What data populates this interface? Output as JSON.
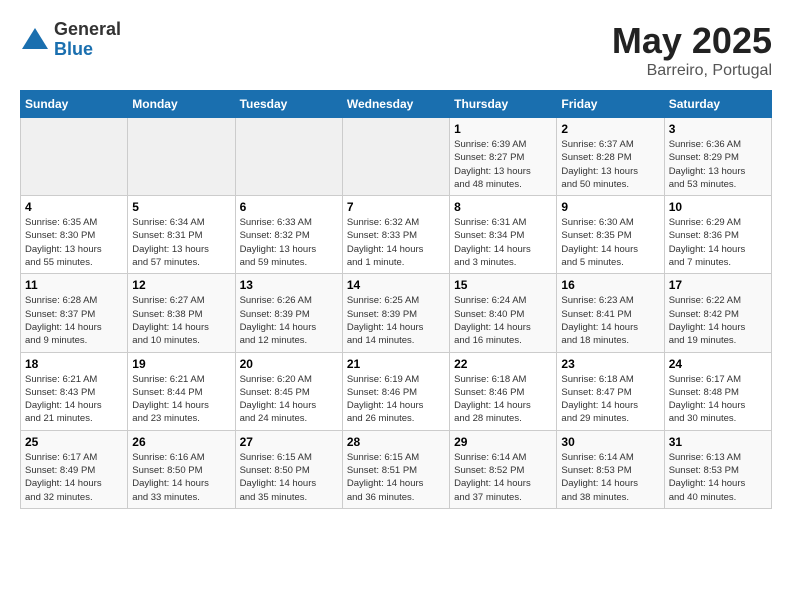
{
  "header": {
    "logo_general": "General",
    "logo_blue": "Blue",
    "title": "May 2025",
    "subtitle": "Barreiro, Portugal"
  },
  "weekdays": [
    "Sunday",
    "Monday",
    "Tuesday",
    "Wednesday",
    "Thursday",
    "Friday",
    "Saturday"
  ],
  "weeks": [
    [
      {
        "day": "",
        "info": ""
      },
      {
        "day": "",
        "info": ""
      },
      {
        "day": "",
        "info": ""
      },
      {
        "day": "",
        "info": ""
      },
      {
        "day": "1",
        "info": "Sunrise: 6:39 AM\nSunset: 8:27 PM\nDaylight: 13 hours\nand 48 minutes."
      },
      {
        "day": "2",
        "info": "Sunrise: 6:37 AM\nSunset: 8:28 PM\nDaylight: 13 hours\nand 50 minutes."
      },
      {
        "day": "3",
        "info": "Sunrise: 6:36 AM\nSunset: 8:29 PM\nDaylight: 13 hours\nand 53 minutes."
      }
    ],
    [
      {
        "day": "4",
        "info": "Sunrise: 6:35 AM\nSunset: 8:30 PM\nDaylight: 13 hours\nand 55 minutes."
      },
      {
        "day": "5",
        "info": "Sunrise: 6:34 AM\nSunset: 8:31 PM\nDaylight: 13 hours\nand 57 minutes."
      },
      {
        "day": "6",
        "info": "Sunrise: 6:33 AM\nSunset: 8:32 PM\nDaylight: 13 hours\nand 59 minutes."
      },
      {
        "day": "7",
        "info": "Sunrise: 6:32 AM\nSunset: 8:33 PM\nDaylight: 14 hours\nand 1 minute."
      },
      {
        "day": "8",
        "info": "Sunrise: 6:31 AM\nSunset: 8:34 PM\nDaylight: 14 hours\nand 3 minutes."
      },
      {
        "day": "9",
        "info": "Sunrise: 6:30 AM\nSunset: 8:35 PM\nDaylight: 14 hours\nand 5 minutes."
      },
      {
        "day": "10",
        "info": "Sunrise: 6:29 AM\nSunset: 8:36 PM\nDaylight: 14 hours\nand 7 minutes."
      }
    ],
    [
      {
        "day": "11",
        "info": "Sunrise: 6:28 AM\nSunset: 8:37 PM\nDaylight: 14 hours\nand 9 minutes."
      },
      {
        "day": "12",
        "info": "Sunrise: 6:27 AM\nSunset: 8:38 PM\nDaylight: 14 hours\nand 10 minutes."
      },
      {
        "day": "13",
        "info": "Sunrise: 6:26 AM\nSunset: 8:39 PM\nDaylight: 14 hours\nand 12 minutes."
      },
      {
        "day": "14",
        "info": "Sunrise: 6:25 AM\nSunset: 8:39 PM\nDaylight: 14 hours\nand 14 minutes."
      },
      {
        "day": "15",
        "info": "Sunrise: 6:24 AM\nSunset: 8:40 PM\nDaylight: 14 hours\nand 16 minutes."
      },
      {
        "day": "16",
        "info": "Sunrise: 6:23 AM\nSunset: 8:41 PM\nDaylight: 14 hours\nand 18 minutes."
      },
      {
        "day": "17",
        "info": "Sunrise: 6:22 AM\nSunset: 8:42 PM\nDaylight: 14 hours\nand 19 minutes."
      }
    ],
    [
      {
        "day": "18",
        "info": "Sunrise: 6:21 AM\nSunset: 8:43 PM\nDaylight: 14 hours\nand 21 minutes."
      },
      {
        "day": "19",
        "info": "Sunrise: 6:21 AM\nSunset: 8:44 PM\nDaylight: 14 hours\nand 23 minutes."
      },
      {
        "day": "20",
        "info": "Sunrise: 6:20 AM\nSunset: 8:45 PM\nDaylight: 14 hours\nand 24 minutes."
      },
      {
        "day": "21",
        "info": "Sunrise: 6:19 AM\nSunset: 8:46 PM\nDaylight: 14 hours\nand 26 minutes."
      },
      {
        "day": "22",
        "info": "Sunrise: 6:18 AM\nSunset: 8:46 PM\nDaylight: 14 hours\nand 28 minutes."
      },
      {
        "day": "23",
        "info": "Sunrise: 6:18 AM\nSunset: 8:47 PM\nDaylight: 14 hours\nand 29 minutes."
      },
      {
        "day": "24",
        "info": "Sunrise: 6:17 AM\nSunset: 8:48 PM\nDaylight: 14 hours\nand 30 minutes."
      }
    ],
    [
      {
        "day": "25",
        "info": "Sunrise: 6:17 AM\nSunset: 8:49 PM\nDaylight: 14 hours\nand 32 minutes."
      },
      {
        "day": "26",
        "info": "Sunrise: 6:16 AM\nSunset: 8:50 PM\nDaylight: 14 hours\nand 33 minutes."
      },
      {
        "day": "27",
        "info": "Sunrise: 6:15 AM\nSunset: 8:50 PM\nDaylight: 14 hours\nand 35 minutes."
      },
      {
        "day": "28",
        "info": "Sunrise: 6:15 AM\nSunset: 8:51 PM\nDaylight: 14 hours\nand 36 minutes."
      },
      {
        "day": "29",
        "info": "Sunrise: 6:14 AM\nSunset: 8:52 PM\nDaylight: 14 hours\nand 37 minutes."
      },
      {
        "day": "30",
        "info": "Sunrise: 6:14 AM\nSunset: 8:53 PM\nDaylight: 14 hours\nand 38 minutes."
      },
      {
        "day": "31",
        "info": "Sunrise: 6:13 AM\nSunset: 8:53 PM\nDaylight: 14 hours\nand 40 minutes."
      }
    ]
  ]
}
